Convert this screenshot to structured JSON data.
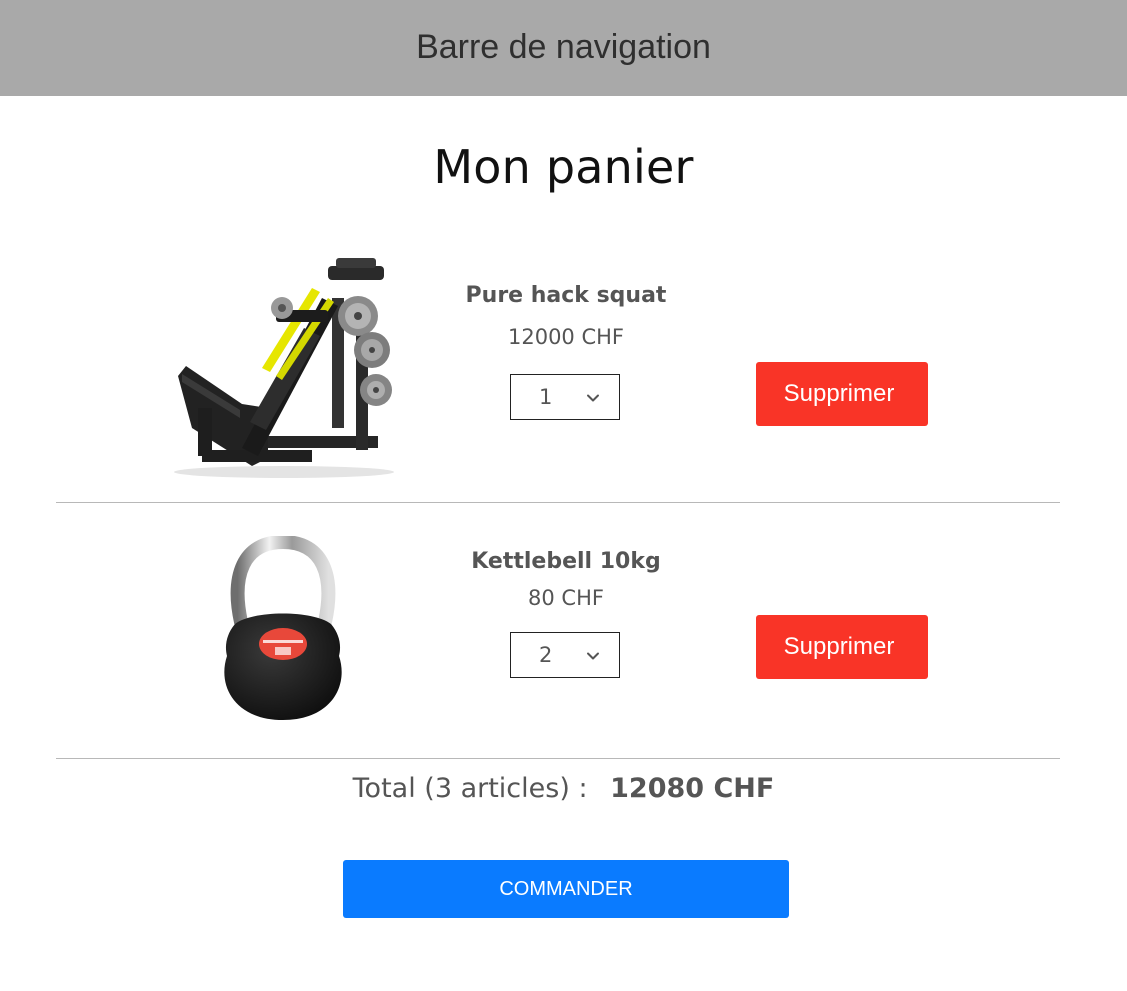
{
  "navbar": {
    "title": "Barre de navigation"
  },
  "page": {
    "title": "Mon panier"
  },
  "cart": {
    "items": [
      {
        "name": "Pure hack squat",
        "price": "12000 CHF",
        "quantity": "1",
        "image_icon": "hack-squat-machine-image",
        "delete_label": "Supprimer"
      },
      {
        "name": "Kettlebell 10kg",
        "price": "80 CHF",
        "quantity": "2",
        "image_icon": "kettlebell-image",
        "delete_label": "Supprimer"
      }
    ],
    "total_label": "Total (3 articles) :",
    "total_amount": "12080 CHF",
    "checkout_label": "COMMANDER"
  },
  "colors": {
    "navbar_bg": "#a9a9a9",
    "delete_button": "#f93427",
    "checkout_button": "#0a7bff"
  }
}
